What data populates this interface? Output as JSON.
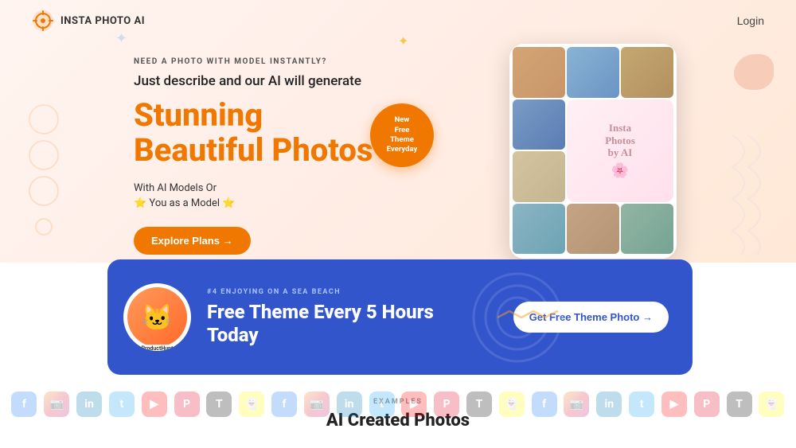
{
  "header": {
    "logo_text": "INSTA PHOTO AI",
    "login_label": "Login"
  },
  "hero": {
    "tagline": "Need a photo with model instantly?",
    "subtitle": "Just describe and our AI will generate",
    "title_line1": "Stunning",
    "title_line2": "Beautiful Photos",
    "model_line": "With AI Models Or",
    "you_model": "You as a Model",
    "explore_label": "Explore Plans →",
    "badge_line1": "New",
    "badge_line2": "Free",
    "badge_line3": "Theme",
    "badge_line4": "Everyday",
    "center_card_text": "Insta\nPhotos\nby AI"
  },
  "promo": {
    "tag": "#4 Enjoying on a Sea Beach",
    "title_line1": "Free Theme Every 5 Hours",
    "title_line2": "Today",
    "cta_label": "Get Free Theme Photo →",
    "mascot_emoji": "🐱",
    "mascot_label": "ProductHunt"
  },
  "bottom": {
    "examples_label": "Examples",
    "section_title": "AI Created Photos"
  },
  "social_icons": [
    {
      "label": "f",
      "class": "si-fb"
    },
    {
      "label": "📷",
      "class": "si-ig"
    },
    {
      "label": "in",
      "class": "si-li"
    },
    {
      "label": "t",
      "class": "si-tw"
    },
    {
      "label": "▶",
      "class": "si-yt"
    },
    {
      "label": "P",
      "class": "si-pi"
    },
    {
      "label": "T",
      "class": "si-tk"
    },
    {
      "label": "👻",
      "class": "si-sn"
    },
    {
      "label": "f",
      "class": "si-fb"
    },
    {
      "label": "📷",
      "class": "si-ig"
    },
    {
      "label": "in",
      "class": "si-li"
    },
    {
      "label": "t",
      "class": "si-tw"
    },
    {
      "label": "▶",
      "class": "si-yt"
    },
    {
      "label": "P",
      "class": "si-pi"
    },
    {
      "label": "T",
      "class": "si-tk"
    },
    {
      "label": "👻",
      "class": "si-sn"
    },
    {
      "label": "f",
      "class": "si-fb"
    },
    {
      "label": "📷",
      "class": "si-ig"
    },
    {
      "label": "in",
      "class": "si-li"
    },
    {
      "label": "t",
      "class": "si-tw"
    },
    {
      "label": "▶",
      "class": "si-yt"
    },
    {
      "label": "P",
      "class": "si-pi"
    },
    {
      "label": "T",
      "class": "si-tk"
    },
    {
      "label": "👻",
      "class": "si-sn"
    }
  ]
}
